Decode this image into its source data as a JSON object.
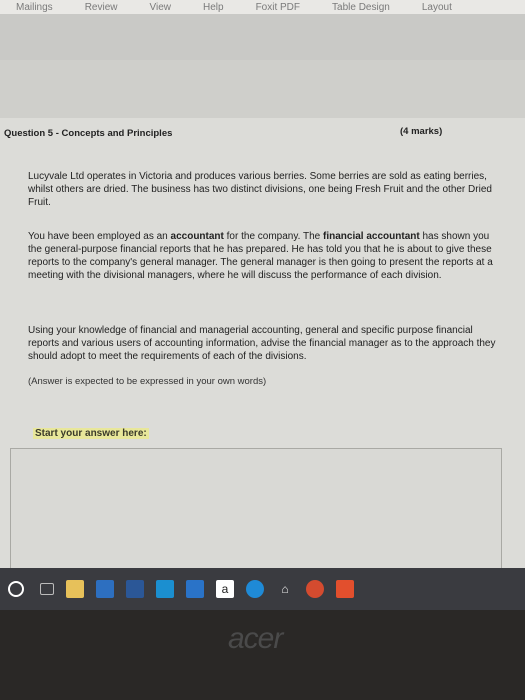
{
  "ribbon": {
    "tabs": [
      "Mailings",
      "Review",
      "View",
      "Help",
      "Foxit PDF",
      "Table Design",
      "Layout"
    ]
  },
  "question": {
    "title": "Question 5 - Concepts and Principles",
    "marks": "(4 marks)",
    "paragraph1": "Lucyvale Ltd operates in Victoria and produces various berries. Some berries are sold as eating berries, whilst others are dried. The business has two distinct divisions, one being Fresh Fruit and the other Dried Fruit.",
    "paragraph2_a": "You have been employed as an ",
    "paragraph2_bold1": "accountant",
    "paragraph2_b": " for the company. The ",
    "paragraph2_bold2": "financial accountant",
    "paragraph2_c": " has shown you the general-purpose financial reports that he has prepared. He has told you that he is about to give these reports to the company's general manager. The general manager is then going to present the reports at a meeting with the divisional managers, where he will discuss the performance of each division.",
    "paragraph3": "Using your knowledge of financial and managerial accounting, general and specific purpose financial reports and various users of accounting information, advise the financial manager as to the approach they should adopt to meet the requirements of each of the divisions.",
    "note": "(Answer is expected to be expressed in your own words)",
    "start_label": "Start your answer here:"
  },
  "taskbar": {
    "icons": [
      "start-icon",
      "task-view-icon",
      "file-explorer-icon",
      "mail-icon",
      "word-icon",
      "photos-icon",
      "store-icon",
      "amazon-icon",
      "edge-icon",
      "home-icon",
      "chrome-icon",
      "foxit-icon"
    ]
  },
  "bezel": {
    "brand": "acer"
  }
}
